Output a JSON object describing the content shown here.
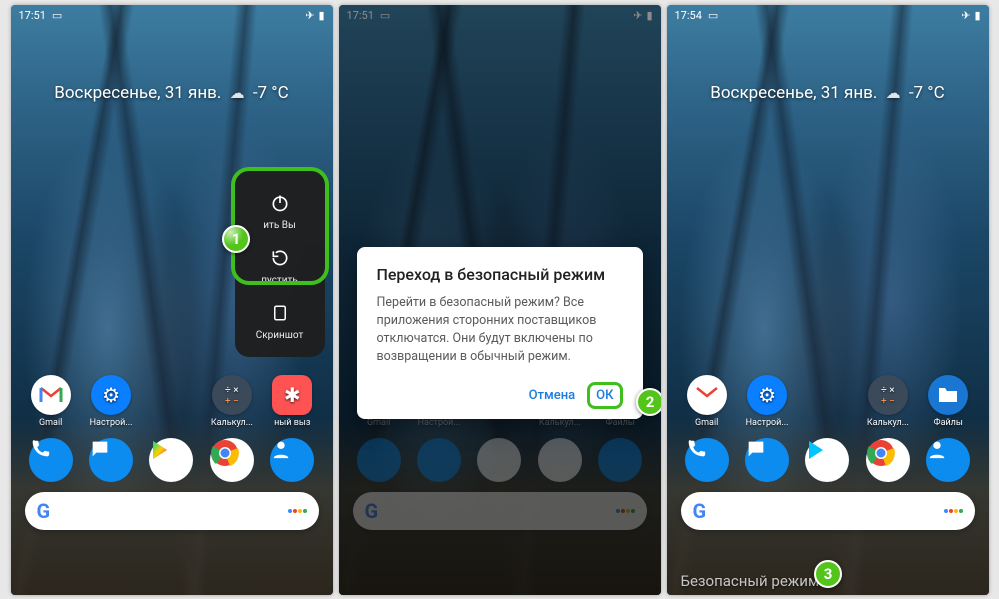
{
  "status": {
    "time1": "17:51",
    "time3": "17:54",
    "temp": "-7 °C"
  },
  "date": "Воскресенье, 31 янв.",
  "apps": {
    "gmail": "Gmail",
    "settings": "Настрой...",
    "calc": "Калькул...",
    "files": "Файлы",
    "ecall": "ный выз"
  },
  "power": {
    "off": "Выключить",
    "off_short": "ить  Вы",
    "restart": "пустить",
    "screenshot": "Скриншот"
  },
  "dialog": {
    "title": "Переход в безопасный режим",
    "body": "Перейти в безопасный режим? Все приложения сторонних поставщиков отключатся. Они будут включены по возвращении в обычный режим.",
    "cancel": "Отмена",
    "ok": "ОК"
  },
  "safemode": "Безопасный режим",
  "badges": {
    "b1": "1",
    "b2": "2",
    "b3": "3"
  }
}
